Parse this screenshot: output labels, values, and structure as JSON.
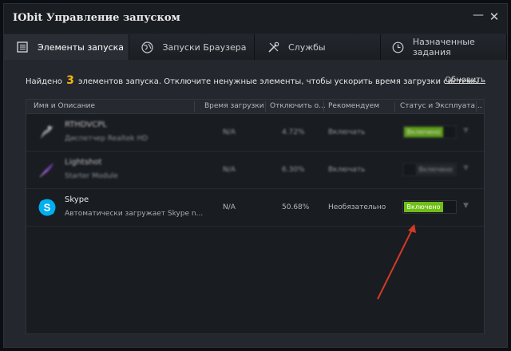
{
  "window": {
    "title": "IObit Управление запуском",
    "minimize_glyph": "—",
    "close_glyph": "✕"
  },
  "tabs": [
    {
      "label": "Элементы запуска",
      "icon": "list-icon",
      "active": true
    },
    {
      "label": "Запуски Браузера",
      "icon": "globe-icon",
      "active": false
    },
    {
      "label": "Службы",
      "icon": "tools-icon",
      "active": false
    },
    {
      "label": "Назначенные задания",
      "icon": "clock-icon",
      "active": false
    }
  ],
  "info": {
    "prefix": "Найдено",
    "count": "3",
    "suffix": "элементов запуска. Отключите ненужные элементы, чтобы ускорить время загрузки системы.",
    "update_link": "Обновить"
  },
  "table": {
    "headers": [
      "Имя и Описание",
      "Время загрузки",
      "Отключить о...",
      "Рекомендуем",
      "Статус и Эксплуата..."
    ],
    "rows": [
      {
        "name": "RTHDVCPL",
        "description": "Диспетчер Realtek HD",
        "time": "N/A",
        "percent": "4.72%",
        "recommend": "Включать",
        "status": "Включено",
        "status_on": true,
        "icon": "speaker-icon",
        "blurred": true
      },
      {
        "name": "Lightshot",
        "description": "Starter Module",
        "time": "N/A",
        "percent": "6.30%",
        "recommend": "Включать",
        "status": "Включено",
        "status_on": false,
        "icon": "feather-icon",
        "blurred": true
      },
      {
        "name": "Skype",
        "description": "Автоматически загружает Skype n...",
        "time": "N/A",
        "percent": "50.68%",
        "recommend": "Необязательно",
        "status": "Включено",
        "status_on": true,
        "icon": "skype-icon",
        "blurred": false
      }
    ]
  },
  "colors": {
    "accent_count": "#f3b80a",
    "toggle_on": "#6fbd16",
    "annotation_arrow": "#d23a26"
  }
}
